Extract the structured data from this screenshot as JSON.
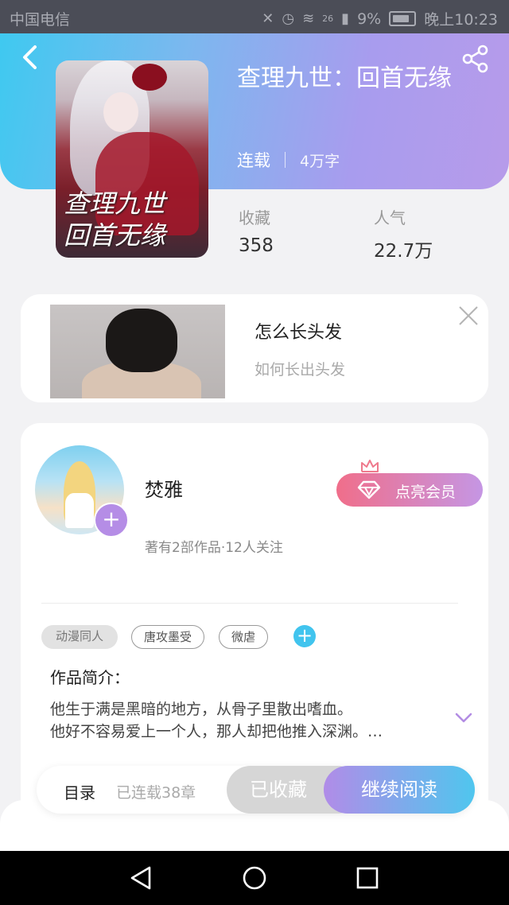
{
  "status_bar": {
    "carrier": "中国电信",
    "network": "26",
    "battery": "9%",
    "time": "晚上10:23"
  },
  "book": {
    "cover_title": "查理九世\n回首无缘",
    "title": "查理九世：回首无缘",
    "status": "连载",
    "word_count": "4万字",
    "favorites_label": "收藏",
    "favorites_value": "358",
    "popularity_label": "人气",
    "popularity_value": "22.7万"
  },
  "ad": {
    "title": "怎么长头发",
    "subtitle": "如何长出头发"
  },
  "author": {
    "name": "焚雅",
    "stats": "著有2部作品·12人关注",
    "vip_label": "点亮会员"
  },
  "tags": [
    "动漫同人",
    "唐攻墨受",
    "微虐"
  ],
  "intro": {
    "label": "作品简介：",
    "text_line1": "他生于满是黑暗的地方，从骨子里散出嗜血。",
    "text_line2": "他好不容易爱上一个人，那人却把他推入深渊。…"
  },
  "bottom_bar": {
    "toc_label": "目录",
    "chapter_count": "已连载38章",
    "collected_label": "已收藏",
    "continue_label": "继续阅读"
  },
  "colors": {
    "header_start": "#3fc9f0",
    "header_end": "#b79bea",
    "accent_purple": "#b58de6",
    "accent_blue": "#41c4ee"
  }
}
